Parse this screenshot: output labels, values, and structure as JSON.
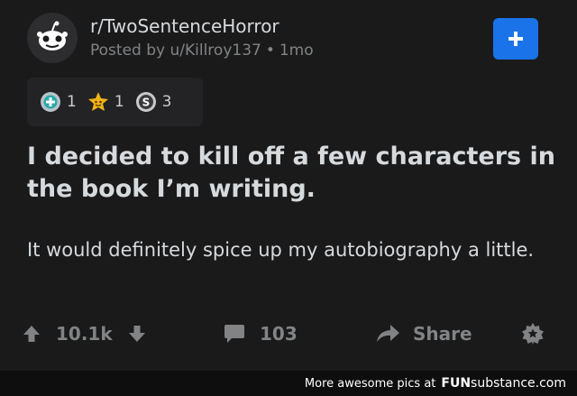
{
  "post": {
    "subreddit": "r/TwoSentenceHorror",
    "posted_by": "Posted by u/Killroy137",
    "age": "1mo",
    "awards": [
      {
        "icon": "helpful-award-icon",
        "count": "1"
      },
      {
        "icon": "wholesome-award-icon",
        "count": "1"
      },
      {
        "icon": "silver-award-icon",
        "count": "3"
      }
    ],
    "title": "I decided to kill off a few characters in the book I’m writing.",
    "body": "It would definitely spice up my autobiography a little.",
    "score": "10.1k",
    "comments": "103",
    "share_label": "Share"
  },
  "footer": {
    "credit_text": "More awesome pics at",
    "brand_bold": "FUN",
    "brand_rest": "substance.com"
  },
  "colors": {
    "background": "#1a1a1b",
    "join_button": "#1a73e8",
    "muted_text": "#818384"
  }
}
